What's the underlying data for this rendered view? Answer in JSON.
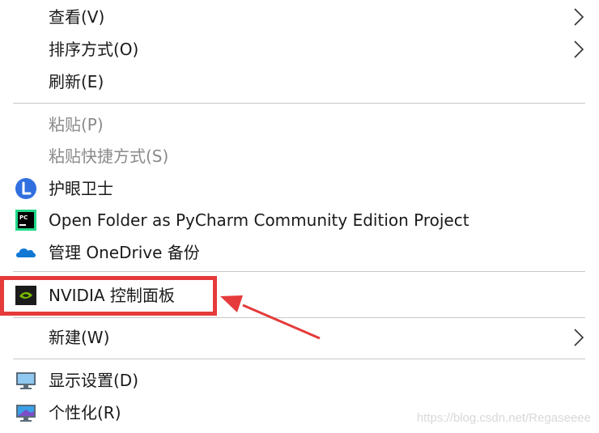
{
  "menu": {
    "items": [
      {
        "label": "查看(V)",
        "has_submenu": true,
        "enabled": true
      },
      {
        "label": "排序方式(O)",
        "has_submenu": true,
        "enabled": true
      },
      {
        "label": "刷新(E)",
        "has_submenu": false,
        "enabled": true
      },
      {
        "label": "粘贴(P)",
        "has_submenu": false,
        "enabled": false
      },
      {
        "label": "粘贴快捷方式(S)",
        "has_submenu": false,
        "enabled": false
      },
      {
        "label": "护眼卫士",
        "icon": "eye-guard-icon",
        "enabled": true
      },
      {
        "label": "Open Folder as PyCharm Community Edition Project",
        "icon": "pycharm-icon",
        "enabled": true
      },
      {
        "label": "管理 OneDrive 备份",
        "icon": "onedrive-cloud-icon",
        "enabled": true
      },
      {
        "label": "NVIDIA 控制面板",
        "icon": "nvidia-icon",
        "enabled": true,
        "highlighted": true
      },
      {
        "label": "新建(W)",
        "has_submenu": true,
        "enabled": true
      },
      {
        "label": "显示设置(D)",
        "icon": "display-monitor-icon",
        "enabled": true
      },
      {
        "label": "个性化(R)",
        "icon": "personalize-monitor-icon",
        "enabled": true
      }
    ]
  },
  "annotation": {
    "highlight_color": "#e53b3b"
  },
  "watermark": "https://blog.csdn.net/Regaseeee"
}
